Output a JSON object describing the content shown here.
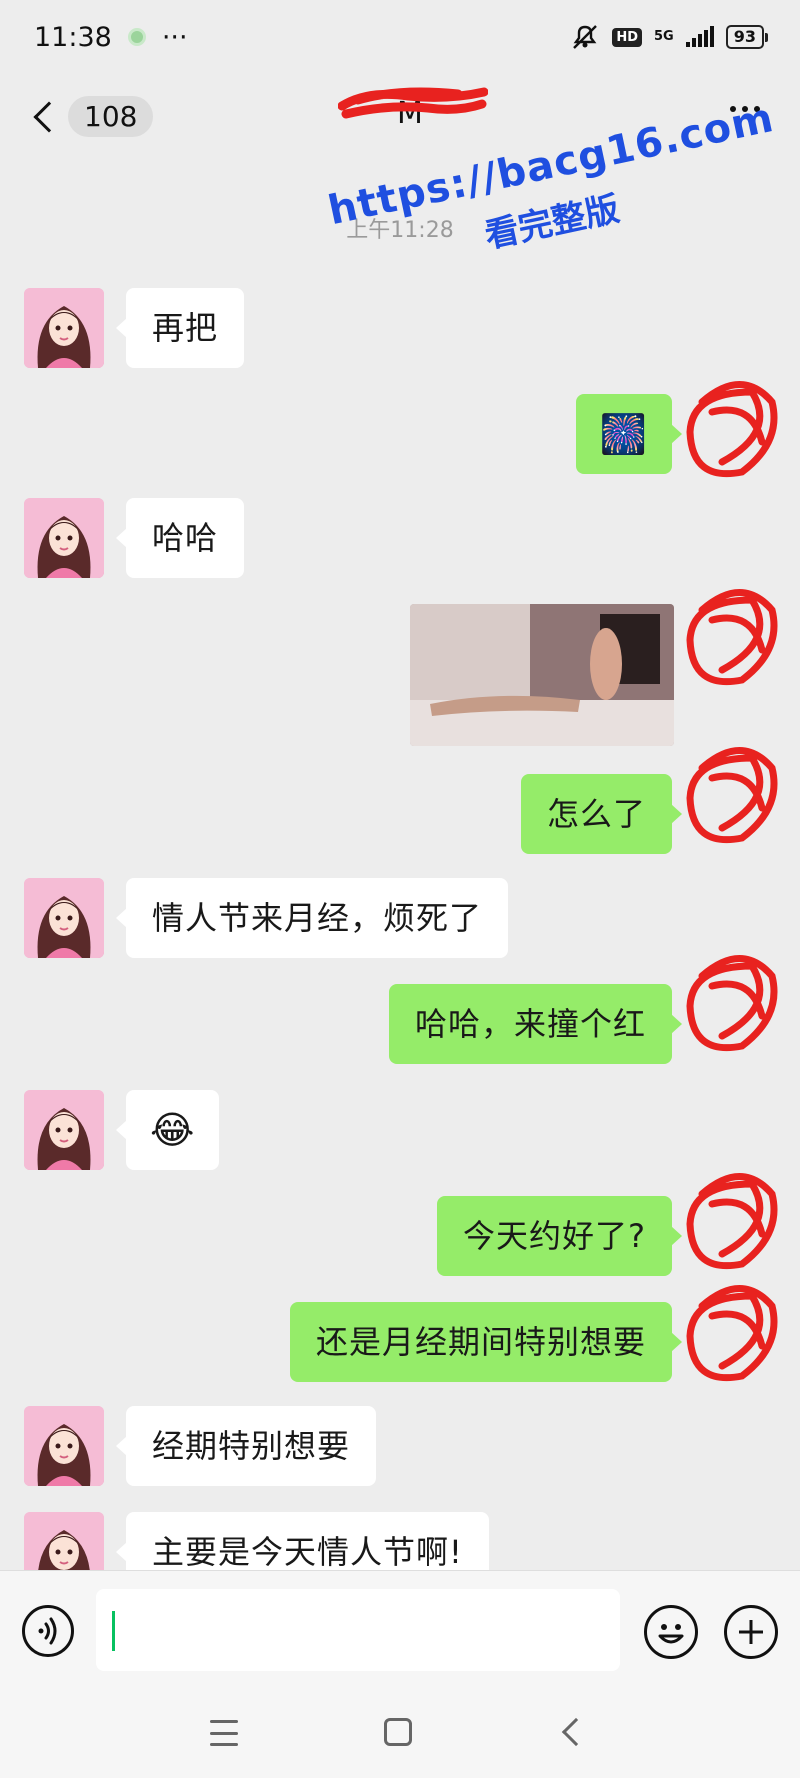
{
  "status_bar": {
    "time": "11:38",
    "more": "···",
    "hd": "HD",
    "network": "5G",
    "battery": "93"
  },
  "header": {
    "unread_count": "108",
    "contact_name": "M"
  },
  "watermark": {
    "line1": "https://bacg16.com",
    "line2": "看完整版"
  },
  "messages": {
    "timestamp": "上午11:28",
    "m1": "再把",
    "m2_emoji": "🎆",
    "m3": "哈哈",
    "m5": "怎么了",
    "m6": "情人节来月经，烦死了",
    "m7": "哈哈，来撞个红",
    "m8_emoji": "😂",
    "m9": "今天约好了?",
    "m10": "还是月经期间特别想要",
    "m11": "经期特别想要",
    "m12": "主要是今天情人节啊!"
  },
  "input": {
    "placeholder": ""
  },
  "colors": {
    "background": "#ededed",
    "outgoing_bubble": "#95ec69",
    "incoming_bubble": "#ffffff",
    "watermark": "#1f4fe0",
    "redaction": "#e8221f"
  },
  "icons": {
    "voice": "voice-icon",
    "emoji": "emoji-icon",
    "plus": "plus-icon"
  }
}
